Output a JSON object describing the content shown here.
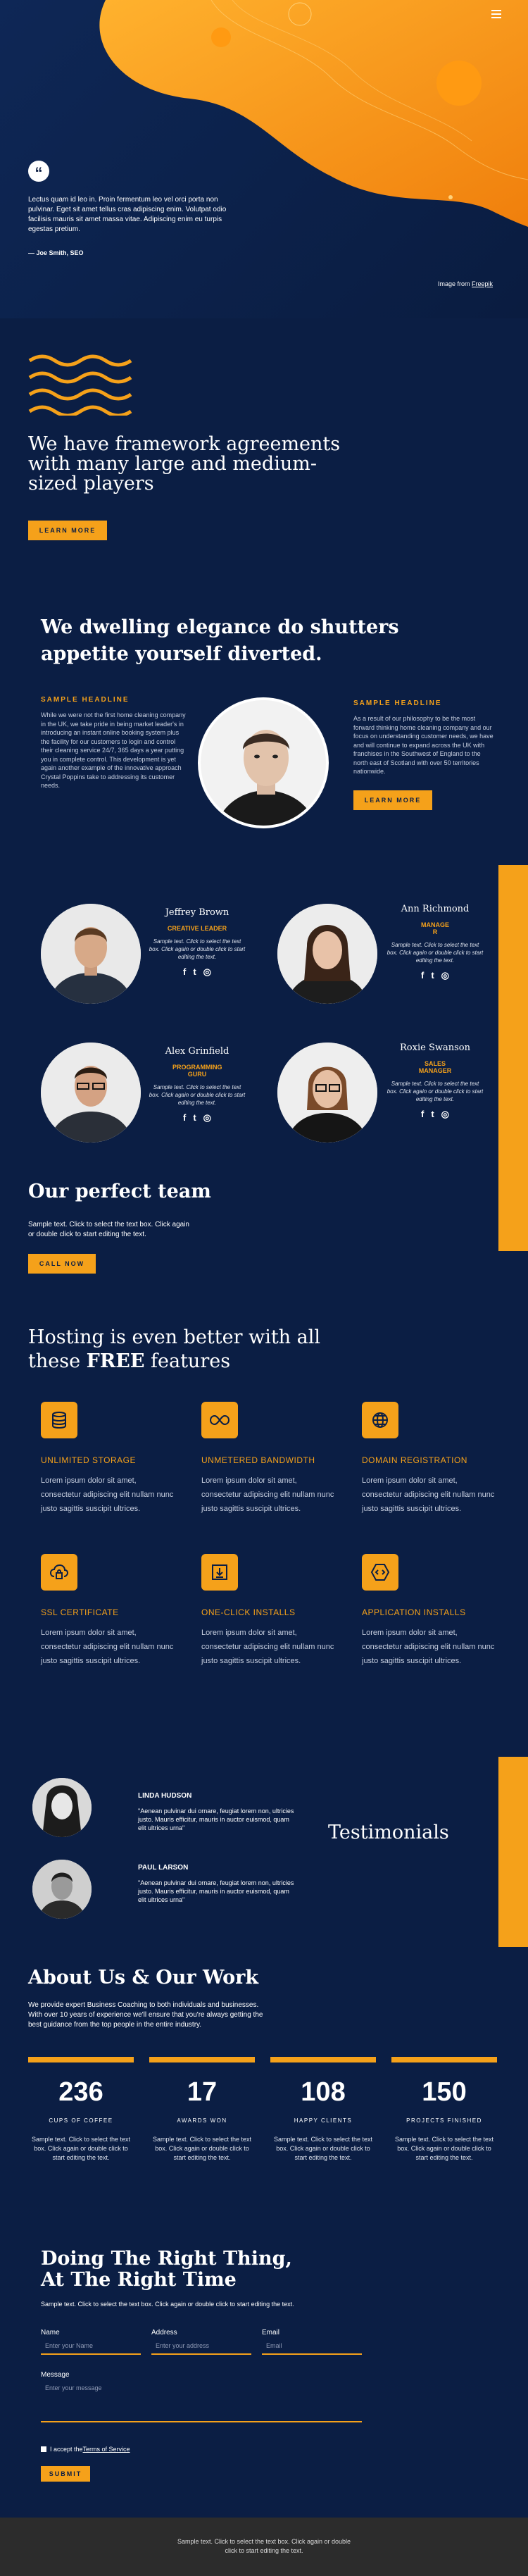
{
  "hero": {
    "quote": "Lectus quam id leo in. Proin fermentum leo vel orci porta non pulvinar. Eget sit amet tellus cras adipiscing enim. Volutpat odio facilisis mauris sit amet massa vitae. Adipiscing enim eu turpis egestas pretium.",
    "author": "— Joe Smith, SEO",
    "credit_prefix": "Image from ",
    "credit_link": "Freepik",
    "menu_icon": "hamburger-icon"
  },
  "framework": {
    "title": "We have framework agreements with many large and medium-sized players",
    "button": "LEARN MORE",
    "wave_icon": "wave-lines-icon"
  },
  "dwelling": {
    "title": "We dwelling elegance do shutters appetite yourself diverted.",
    "left_heading": "SAMPLE HEADLINE",
    "left_text": "While we were not the first home cleaning company in the UK, we take pride in being market leader's in introducing an instant online booking system plus the facility for our customers to login and control their cleaning service 24/7, 365 days a year putting you in complete control. This development is yet again another example of the innovative approach Crystal Poppins take to addressing its customer needs.",
    "right_heading": "SAMPLE HEADLINE",
    "right_text": "As a result of our philosophy to be the most forward thinking home cleaning company and our focus on understanding customer needs, we have and will continue to expand across the UK with franchises in the Southwest of England to the north east of Scotland with over 50 territories nationwide.",
    "button": "LEARN MORE"
  },
  "team": {
    "members": [
      {
        "name": "Jeffrey Brown",
        "role": "CREATIVE LEADER",
        "bio": "Sample text. Click to select the text box. Click again or double click to start editing the text."
      },
      {
        "name": "Ann Richmond",
        "role": "MANAGE R",
        "bio": "Sample text. Click to select the text box. Click again or double click to start editing the text."
      },
      {
        "name": "Alex Grinfield",
        "role": "PROGRAMMING GURU",
        "bio": "Sample text. Click to select the text box. Click again or double click to start editing the text."
      },
      {
        "name": "Roxie Swanson",
        "role": "SALES MANAGER",
        "bio": "Sample text. Click to select the text box. Click again or double click to start editing the text."
      }
    ],
    "social": [
      "f",
      "t",
      "ig"
    ],
    "title": "Our perfect team",
    "text": "Sample text. Click to select the text box. Click again or double click to start editing the text.",
    "button": "CALL NOW"
  },
  "hosting": {
    "title_start": "Hosting is even better with all these ",
    "title_strong": "FREE",
    "title_end": " features",
    "features": [
      {
        "title": "UNLIMITED STORAGE",
        "icon": "database-icon",
        "text": "Lorem ipsum dolor sit amet, consectetur adipiscing elit nullam nunc justo sagittis suscipit ultrices."
      },
      {
        "title": "UNMETERED BANDWIDTH",
        "icon": "infinity-icon",
        "text": "Lorem ipsum dolor sit amet, consectetur adipiscing elit nullam nunc justo sagittis suscipit ultrices."
      },
      {
        "title": "DOMAIN REGISTRATION",
        "icon": "globe-icon",
        "text": "Lorem ipsum dolor sit amet, consectetur adipiscing elit nullam nunc justo sagittis suscipit ultrices."
      },
      {
        "title": "SSL CERTIFICATE",
        "icon": "cloud-lock-icon",
        "text": "Lorem ipsum dolor sit amet, consectetur adipiscing elit nullam nunc justo sagittis suscipit ultrices."
      },
      {
        "title": "ONE-CLICK INSTALLS",
        "icon": "install-icon",
        "text": "Lorem ipsum dolor sit amet, consectetur adipiscing elit nullam nunc justo sagittis suscipit ultrices."
      },
      {
        "title": "APPLICATION INSTALLS",
        "icon": "html-icon",
        "text": "Lorem ipsum dolor sit amet, consectetur adipiscing elit nullam nunc justo sagittis suscipit ultrices."
      }
    ]
  },
  "testimonials": {
    "title": "Testimonials",
    "items": [
      {
        "name": "LINDA HUDSON",
        "text": "\"Aenean pulvinar dui ornare, feugiat lorem non, ultricies justo. Mauris efficitur, mauris in auctor euismod, quam elit ultrices urna\""
      },
      {
        "name": "PAUL LARSON",
        "text": "\"Aenean pulvinar dui ornare, feugiat lorem non, ultricies justo. Mauris efficitur, mauris in auctor euismod, quam elit ultrices urna\""
      }
    ]
  },
  "about": {
    "title": "About Us & Our Work",
    "text": "We provide expert Business Coaching to both individuals and businesses. With over 10 years of experience we'll ensure that you're always getting the best guidance from the top people in the entire industry.",
    "stats": [
      {
        "value": "236",
        "label": "CUPS OF COFFEE",
        "text": "Sample text. Click to select the text box. Click again or double click to start editing the text."
      },
      {
        "value": "17",
        "label": "AWARDS WON",
        "text": "Sample text. Click to select the text box. Click again or double click to start editing the text."
      },
      {
        "value": "108",
        "label": "HAPPY CLIENTS",
        "text": "Sample text. Click to select the text box. Click again or double click to start editing the text."
      },
      {
        "value": "150",
        "label": "PROJECTS FINISHED",
        "text": "Sample text. Click to select the text box. Click again or double click to start editing the text."
      }
    ]
  },
  "contact": {
    "title": "Doing The Right Thing, At The Right Time",
    "text": "Sample text. Click to select the text box. Click again or double click to start editing the text.",
    "name_label": "Name",
    "name_placeholder": "Enter your Name",
    "address_label": "Address",
    "address_placeholder": "Enter your address",
    "email_label": "Email",
    "email_placeholder": "Email",
    "message_label": "Message",
    "message_placeholder": "Enter your message",
    "terms_prefix": "I accept the ",
    "terms_link": "Terms of Service",
    "submit": "SUBMIT"
  },
  "footer": {
    "text": "Sample text. Click to select the text box. Click again or double click to start editing the text."
  },
  "colors": {
    "accent": "#f5a11a",
    "background": "#0b1e44",
    "footer": "#2c2c2c"
  }
}
